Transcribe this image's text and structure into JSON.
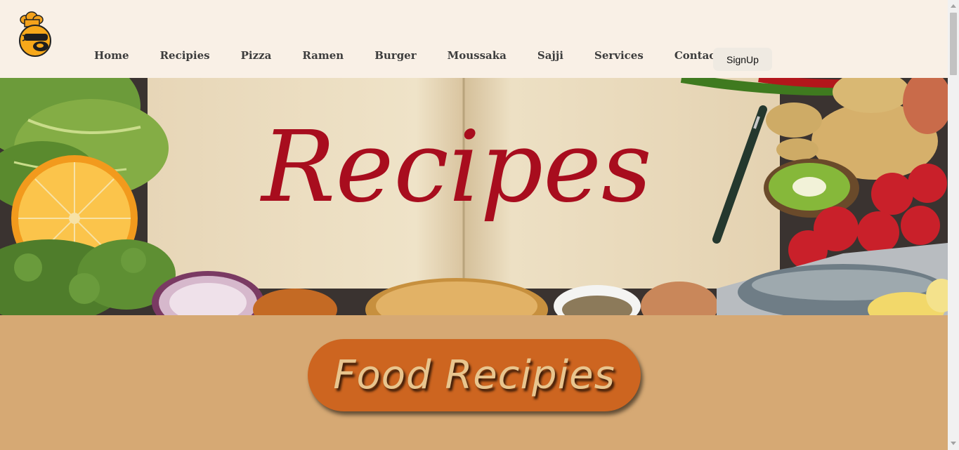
{
  "nav": {
    "items": [
      {
        "label": "Home"
      },
      {
        "label": "Recipies"
      },
      {
        "label": "Pizza"
      },
      {
        "label": "Ramen"
      },
      {
        "label": "Burger"
      },
      {
        "label": "Moussaka"
      },
      {
        "label": "Sajji"
      },
      {
        "label": "Services"
      },
      {
        "label": "Contact Us"
      }
    ],
    "signup_label": "SignUp"
  },
  "logo": {
    "icon": "chef-face-icon"
  },
  "hero": {
    "title": "Recipes"
  },
  "section": {
    "heading": "Food Recipies"
  },
  "colors": {
    "header_bg": "#f9f0e6",
    "section_bg": "#d6a974",
    "pill_bg": "#cd6520",
    "hero_title": "#a80d1e"
  }
}
